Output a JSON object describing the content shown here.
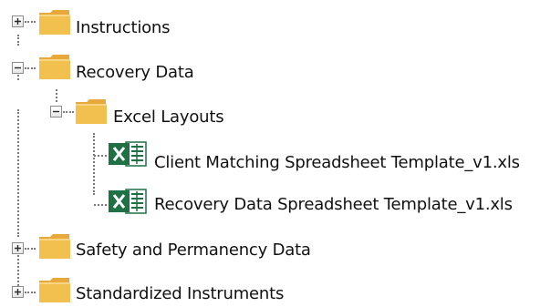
{
  "tree": {
    "items": [
      {
        "label": "Instructions",
        "expanded": false,
        "icon": "folder-icon"
      },
      {
        "label": "Recovery Data",
        "expanded": true,
        "icon": "folder-icon",
        "children": [
          {
            "label": "Excel Layouts",
            "expanded": true,
            "icon": "folder-icon",
            "children": [
              {
                "label": "Client Matching Spreadsheet Template_v1.xls",
                "icon": "excel-file-icon"
              },
              {
                "label": "Recovery Data Spreadsheet Template_v1.xls",
                "icon": "excel-file-icon"
              }
            ]
          }
        ]
      },
      {
        "label": "Safety and Permanency Data",
        "expanded": false,
        "icon": "folder-icon"
      },
      {
        "label": "Standardized Instruments",
        "expanded": false,
        "icon": "folder-icon"
      }
    ]
  },
  "colors": {
    "folder_body": "#f2c04e",
    "folder_tab": "#e8a93a",
    "excel_green": "#1e7145",
    "connector": "#7a7a7a"
  }
}
